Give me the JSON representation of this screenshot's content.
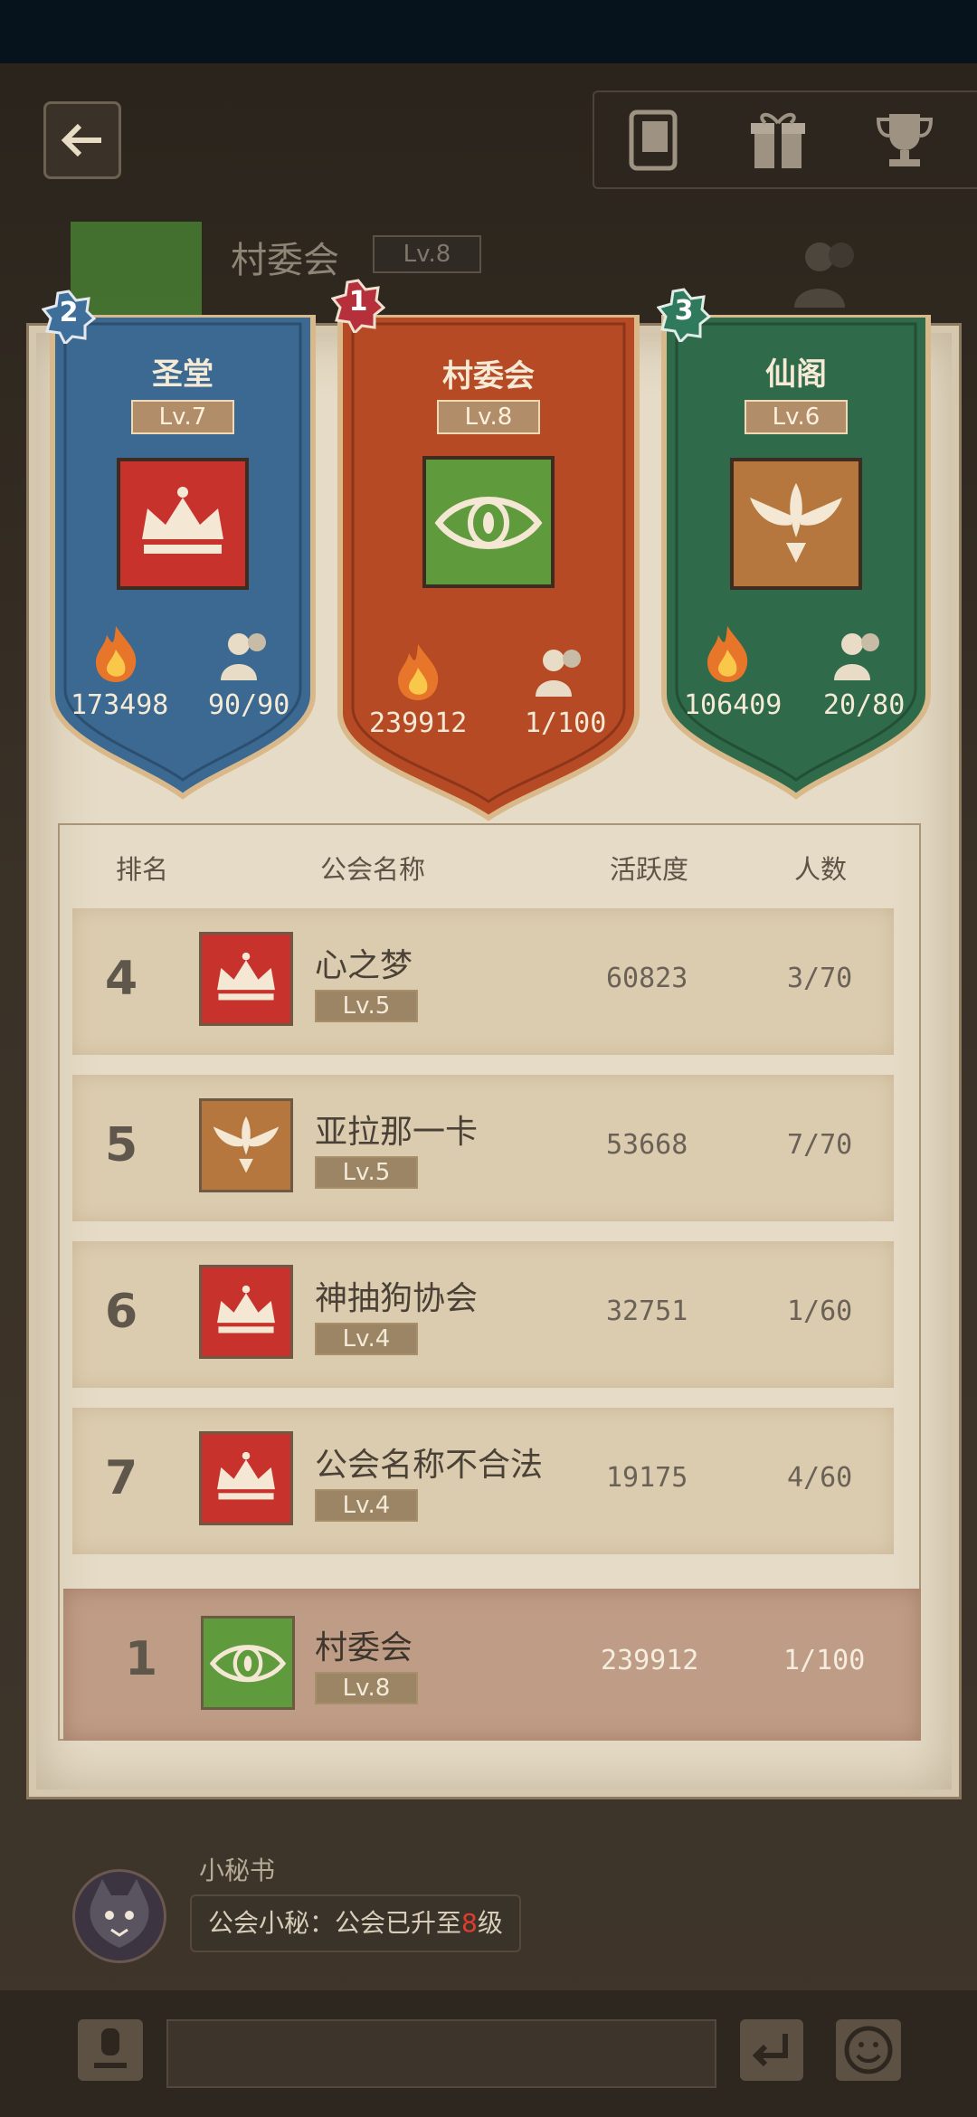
{
  "header": {
    "guild_name": "村委会",
    "guild_level": "Lv.8",
    "icons": [
      "back-arrow-icon",
      "scroll-icon",
      "gift-icon",
      "trophy-icon",
      "members-icon"
    ]
  },
  "colors": {
    "blue_banner": "#3c6991",
    "orange_banner": "#b54a25",
    "green_banner": "#2f6a4a",
    "crown_emblem": "#c8322c",
    "eye_emblem": "#5f9a3c",
    "phoenix_emblem": "#b5773d",
    "highlight_row": "#bf9c85",
    "level_red": "#e23c2e"
  },
  "podium": [
    {
      "rank": "1",
      "name": "村委会",
      "level": "Lv.8",
      "activity": "239912",
      "members": "1/100",
      "emblem": "eye-emblem"
    },
    {
      "rank": "2",
      "name": "圣堂",
      "level": "Lv.7",
      "activity": "173498",
      "members": "90/90",
      "emblem": "crown-emblem"
    },
    {
      "rank": "3",
      "name": "仙阁",
      "level": "Lv.6",
      "activity": "106409",
      "members": "20/80",
      "emblem": "phoenix-emblem"
    }
  ],
  "table": {
    "headers": {
      "rank": "排名",
      "name": "公会名称",
      "activity": "活跃度",
      "members": "人数"
    },
    "rows": [
      {
        "rank": "4",
        "name": "心之梦",
        "level": "Lv.5",
        "activity": "60823",
        "members": "3/70",
        "emblem": "crown-emblem"
      },
      {
        "rank": "5",
        "name": "亚拉那一卡",
        "level": "Lv.5",
        "activity": "53668",
        "members": "7/70",
        "emblem": "phoenix-emblem"
      },
      {
        "rank": "6",
        "name": "神抽狗协会",
        "level": "Lv.4",
        "activity": "32751",
        "members": "1/60",
        "emblem": "crown-emblem"
      },
      {
        "rank": "7",
        "name": "公会名称不合法",
        "level": "Lv.4",
        "activity": "19175",
        "members": "4/60",
        "emblem": "crown-emblem"
      }
    ],
    "my_guild": {
      "rank": "1",
      "name": "村委会",
      "level": "Lv.8",
      "activity": "239912",
      "members": "1/100",
      "emblem": "eye-emblem"
    }
  },
  "chat": {
    "sender": "小秘书",
    "message_prefix": "公会小秘：公会已升至",
    "message_level": "8",
    "message_suffix": "级"
  }
}
